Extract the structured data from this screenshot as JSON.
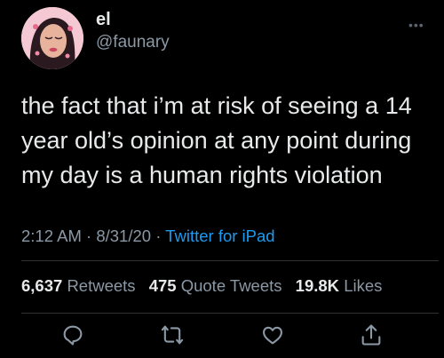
{
  "tweet": {
    "display_name": "el",
    "handle": "@faunary",
    "more_icon": "ellipsis-icon",
    "text": "the fact that i’m at risk of seeing a 14 year old’s opinion at any point during my day is a human rights violation",
    "time": "2:12 AM",
    "date": "8/31/20",
    "separator": "·",
    "source": "Twitter for iPad"
  },
  "stats": {
    "retweets_count": "6,637",
    "retweets_label": "Retweets",
    "quote_count": "475",
    "quote_label": "Quote Tweets",
    "likes_count": "19.8K",
    "likes_label": "Likes"
  },
  "actions": [
    {
      "icon": "reply-icon"
    },
    {
      "icon": "retweet-icon"
    },
    {
      "icon": "like-icon"
    },
    {
      "icon": "share-icon"
    }
  ],
  "colors": {
    "background": "#000000",
    "text": "#e7e9ea",
    "secondary": "#8b98a5",
    "link": "#1d9bf0",
    "avatar_bg": "#f4c9d3"
  }
}
